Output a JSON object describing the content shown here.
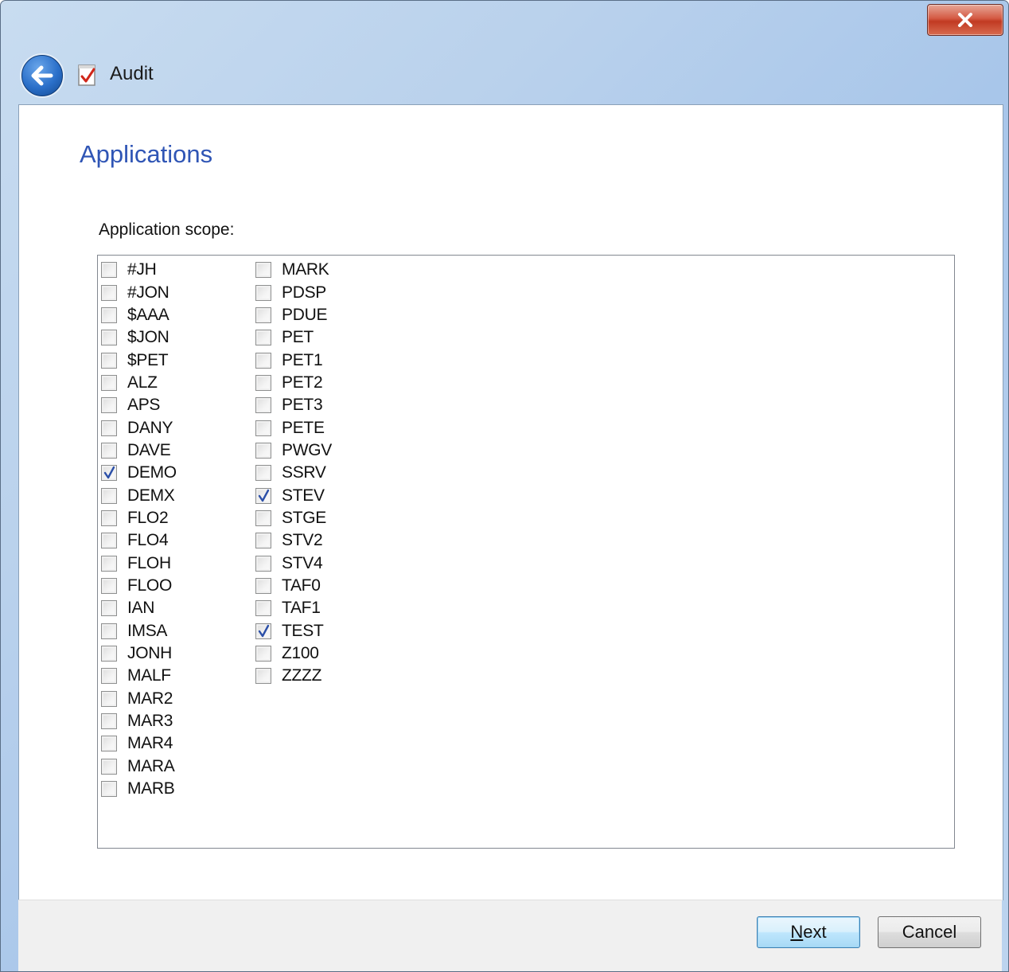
{
  "window": {
    "title": "Audit",
    "close_glyph": "x"
  },
  "page": {
    "title": "Applications",
    "scope_label": "Application scope:"
  },
  "applications": {
    "column1": [
      {
        "label": "#JH",
        "checked": false
      },
      {
        "label": "#JON",
        "checked": false
      },
      {
        "label": "$AAA",
        "checked": false
      },
      {
        "label": "$JON",
        "checked": false
      },
      {
        "label": "$PET",
        "checked": false
      },
      {
        "label": "ALZ",
        "checked": false
      },
      {
        "label": "APS",
        "checked": false
      },
      {
        "label": "DANY",
        "checked": false
      },
      {
        "label": "DAVE",
        "checked": false
      },
      {
        "label": "DEMO",
        "checked": true
      },
      {
        "label": "DEMX",
        "checked": false
      },
      {
        "label": "FLO2",
        "checked": false
      },
      {
        "label": "FLO4",
        "checked": false
      },
      {
        "label": "FLOH",
        "checked": false
      },
      {
        "label": "FLOO",
        "checked": false
      },
      {
        "label": "IAN",
        "checked": false
      },
      {
        "label": "IMSA",
        "checked": false
      },
      {
        "label": "JONH",
        "checked": false
      },
      {
        "label": "MALF",
        "checked": false
      },
      {
        "label": "MAR2",
        "checked": false
      },
      {
        "label": "MAR3",
        "checked": false
      },
      {
        "label": "MAR4",
        "checked": false
      },
      {
        "label": "MARA",
        "checked": false
      },
      {
        "label": "MARB",
        "checked": false
      }
    ],
    "column2": [
      {
        "label": "MARK",
        "checked": false
      },
      {
        "label": "PDSP",
        "checked": false
      },
      {
        "label": "PDUE",
        "checked": false
      },
      {
        "label": "PET",
        "checked": false
      },
      {
        "label": "PET1",
        "checked": false
      },
      {
        "label": "PET2",
        "checked": false
      },
      {
        "label": "PET3",
        "checked": false
      },
      {
        "label": "PETE",
        "checked": false
      },
      {
        "label": "PWGV",
        "checked": false
      },
      {
        "label": "SSRV",
        "checked": false
      },
      {
        "label": "STEV",
        "checked": true
      },
      {
        "label": "STGE",
        "checked": false
      },
      {
        "label": "STV2",
        "checked": false
      },
      {
        "label": "STV4",
        "checked": false
      },
      {
        "label": "TAF0",
        "checked": false
      },
      {
        "label": "TAF1",
        "checked": false
      },
      {
        "label": "TEST",
        "checked": true
      },
      {
        "label": "Z100",
        "checked": false
      },
      {
        "label": "ZZZZ",
        "checked": false
      }
    ]
  },
  "buttons": {
    "next_mnemonic": "N",
    "next_rest": "ext",
    "cancel": "Cancel"
  },
  "colors": {
    "title_blue": "#2f55b5",
    "check_blue": "#2b4fa8",
    "close_red": "#c13a22"
  }
}
